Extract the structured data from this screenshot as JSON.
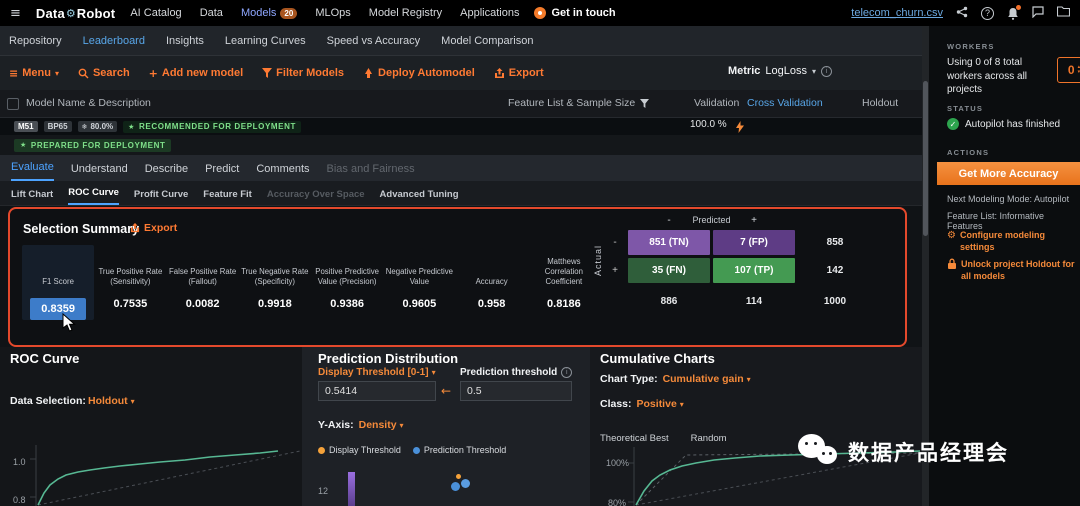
{
  "icons": {
    "hamburger": "≡",
    "gear": "⚙",
    "caret": "▾",
    "caret_up": "▴",
    "plus": "+",
    "check": "✓",
    "question": "?",
    "info": "i",
    "arrow_left": "←",
    "snowflake": "❄",
    "star": "★"
  },
  "topbar": {
    "brand_data": "Data",
    "brand_robot": "Robot",
    "nav": [
      "AI Catalog",
      "Data",
      "Models",
      "MLOps",
      "Model Registry",
      "Applications"
    ],
    "models_badge": "20",
    "get_in_touch": "Get in touch",
    "file_link": "telecom_churn.csv"
  },
  "secondary_nav": {
    "items": [
      "Repository",
      "Leaderboard",
      "Insights",
      "Learning Curves",
      "Speed vs Accuracy",
      "Model Comparison"
    ]
  },
  "toolbar": {
    "menu": "Menu",
    "search": "Search",
    "add_model": "Add new model",
    "filter": "Filter Models",
    "deploy": "Deploy Automodel",
    "export": "Export",
    "metric_label": "Metric",
    "metric_value": "LogLoss"
  },
  "table_header": {
    "model_name": "Model Name & Description",
    "feature_list": "Feature List & Sample Size",
    "validation": "Validation",
    "cross_validation": "Cross Validation",
    "holdout": "Holdout"
  },
  "model_row": {
    "badge_m": "M51",
    "badge_bp": "BP65",
    "badge_pct": "80.0%",
    "recommended": "RECOMMENDED FOR DEPLOYMENT",
    "prepared": "PREPARED FOR DEPLOYMENT",
    "sample_size": "100.0 %"
  },
  "tabs": {
    "items": [
      "Evaluate",
      "Understand",
      "Describe",
      "Predict",
      "Comments",
      "Bias and Fairness"
    ]
  },
  "subtabs": {
    "items": [
      "Lift Chart",
      "ROC Curve",
      "Profit Curve",
      "Feature Fit",
      "Accuracy Over Space",
      "Advanced Tuning"
    ]
  },
  "selection_summary": {
    "title": "Selection Summary",
    "export_label": "Export",
    "metrics": [
      {
        "label": "F1 Score",
        "value": "0.8359"
      },
      {
        "label": "True Positive Rate (Sensitivity)",
        "value": "0.7535"
      },
      {
        "label": "False Positive Rate (Fallout)",
        "value": "0.0082"
      },
      {
        "label": "True Negative Rate (Specificity)",
        "value": "0.9918"
      },
      {
        "label": "Positive Predictive Value (Precision)",
        "value": "0.9386"
      },
      {
        "label": "Negative Predictive Value",
        "value": "0.9605"
      },
      {
        "label": "Accuracy",
        "value": "0.958"
      },
      {
        "label": "Matthews Correlation Coefficient",
        "value": "0.8186"
      }
    ],
    "matrix": {
      "predicted_label": "Predicted",
      "actual_label": "Actual",
      "minus": "-",
      "plus": "+",
      "tn": "851 (TN)",
      "fp": "7 (FP)",
      "row_minus_total": "858",
      "fn": "35 (FN)",
      "tp": "107 (TP)",
      "row_plus_total": "142",
      "col_minus_total": "886",
      "col_plus_total": "114",
      "grand_total": "1000"
    }
  },
  "roc_panel": {
    "title": "ROC Curve",
    "data_selection_label": "Data Selection:",
    "data_selection_value": "Holdout",
    "yticks": [
      "1.0",
      "0.8"
    ]
  },
  "prediction_panel": {
    "title": "Prediction Distribution",
    "display_threshold_label": "Display Threshold [0-1]",
    "display_threshold_value": "0.5414",
    "threshold_label": "Prediction threshold",
    "threshold_value": "0.5",
    "y_axis_label": "Y-Axis:",
    "y_axis_value": "Density",
    "legend": [
      "Display Threshold",
      "Prediction Threshold"
    ],
    "ytick": "12"
  },
  "cumulative_panel": {
    "title": "Cumulative Charts",
    "chart_type_label": "Chart Type:",
    "chart_type_value": "Cumulative gain",
    "class_label": "Class:",
    "class_value": "Positive",
    "legend": [
      "Theoretical Best",
      "Random"
    ],
    "yticks": [
      "100%",
      "80%"
    ]
  },
  "sidebar": {
    "workers_title": "WORKERS",
    "workers_text": "Using 0 of 8 total workers across all projects",
    "workers_count": "0",
    "status_title": "STATUS",
    "status_text": "Autopilot has finished",
    "actions_title": "ACTIONS",
    "accuracy_button": "Get More Accuracy",
    "next_mode": "Next Modeling Mode: Autopilot",
    "feature_list": "Feature List: Informative Features",
    "configure": "Configure modeling settings",
    "unlock": "Unlock project Holdout for all models"
  },
  "watermark": {
    "text": "数据产品经理会"
  }
}
